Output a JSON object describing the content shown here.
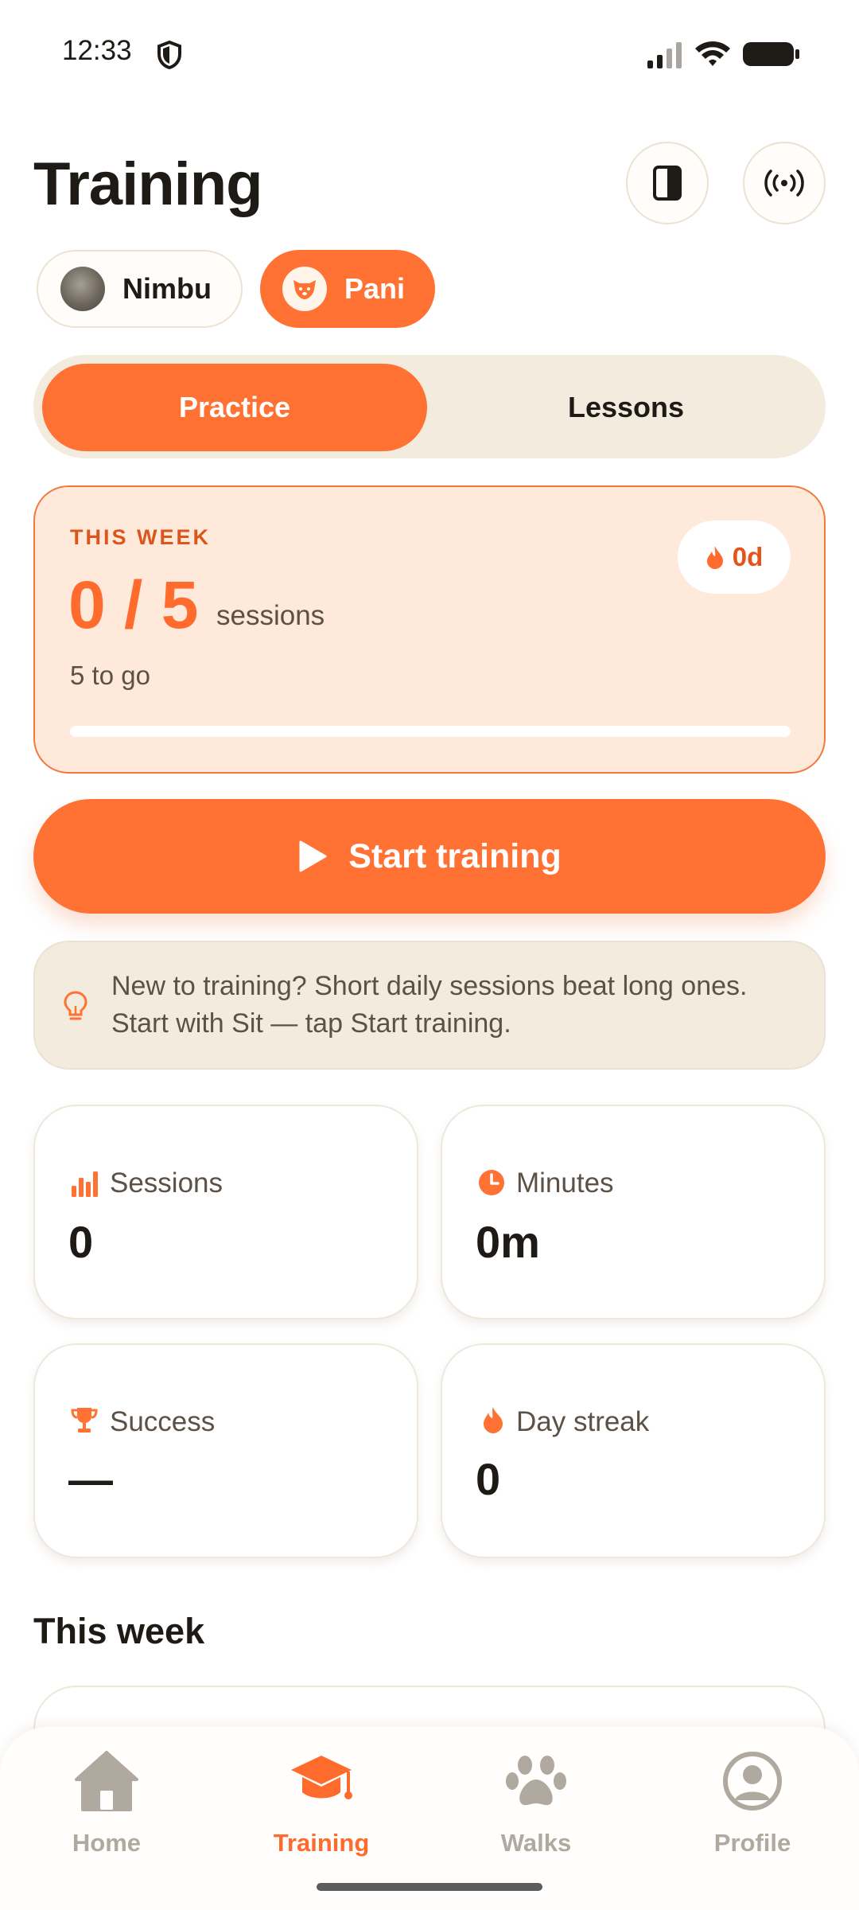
{
  "status_bar": {
    "time": "12:33"
  },
  "header": {
    "title": "Training"
  },
  "pets": [
    {
      "name": "Nimbu",
      "selected": false
    },
    {
      "name": "Pani",
      "selected": true
    }
  ],
  "tabs": [
    {
      "label": "Practice",
      "active": true
    },
    {
      "label": "Lessons",
      "active": false
    }
  ],
  "week_card": {
    "label": "THIS WEEK",
    "streak": "0d",
    "count": "0 / 5",
    "unit": "sessions",
    "remaining": "5 to go",
    "progress": 0
  },
  "start_button": {
    "label": "Start training"
  },
  "tip": {
    "text": "New to training? Short daily sessions beat long ones. Start with Sit — tap Start training."
  },
  "stats": [
    {
      "label": "Sessions",
      "value": "0",
      "icon": "bar-chart-icon"
    },
    {
      "label": "Minutes",
      "value": "0m",
      "icon": "clock-icon"
    },
    {
      "label": "Success",
      "value": "—",
      "icon": "trophy-icon"
    },
    {
      "label": "Day streak",
      "value": "0",
      "icon": "flame-icon"
    }
  ],
  "section": {
    "title": "This week"
  },
  "nav": [
    {
      "label": "Home",
      "icon": "home-icon",
      "active": false
    },
    {
      "label": "Training",
      "icon": "graduation-cap-icon",
      "active": true
    },
    {
      "label": "Walks",
      "icon": "paw-icon",
      "active": false
    },
    {
      "label": "Profile",
      "icon": "user-circle-icon",
      "active": false
    }
  ],
  "colors": {
    "accent": "#ff7233",
    "accent_soft": "#ffe9da",
    "sand": "#f4ebdf",
    "inactive": "#b0a99f"
  }
}
